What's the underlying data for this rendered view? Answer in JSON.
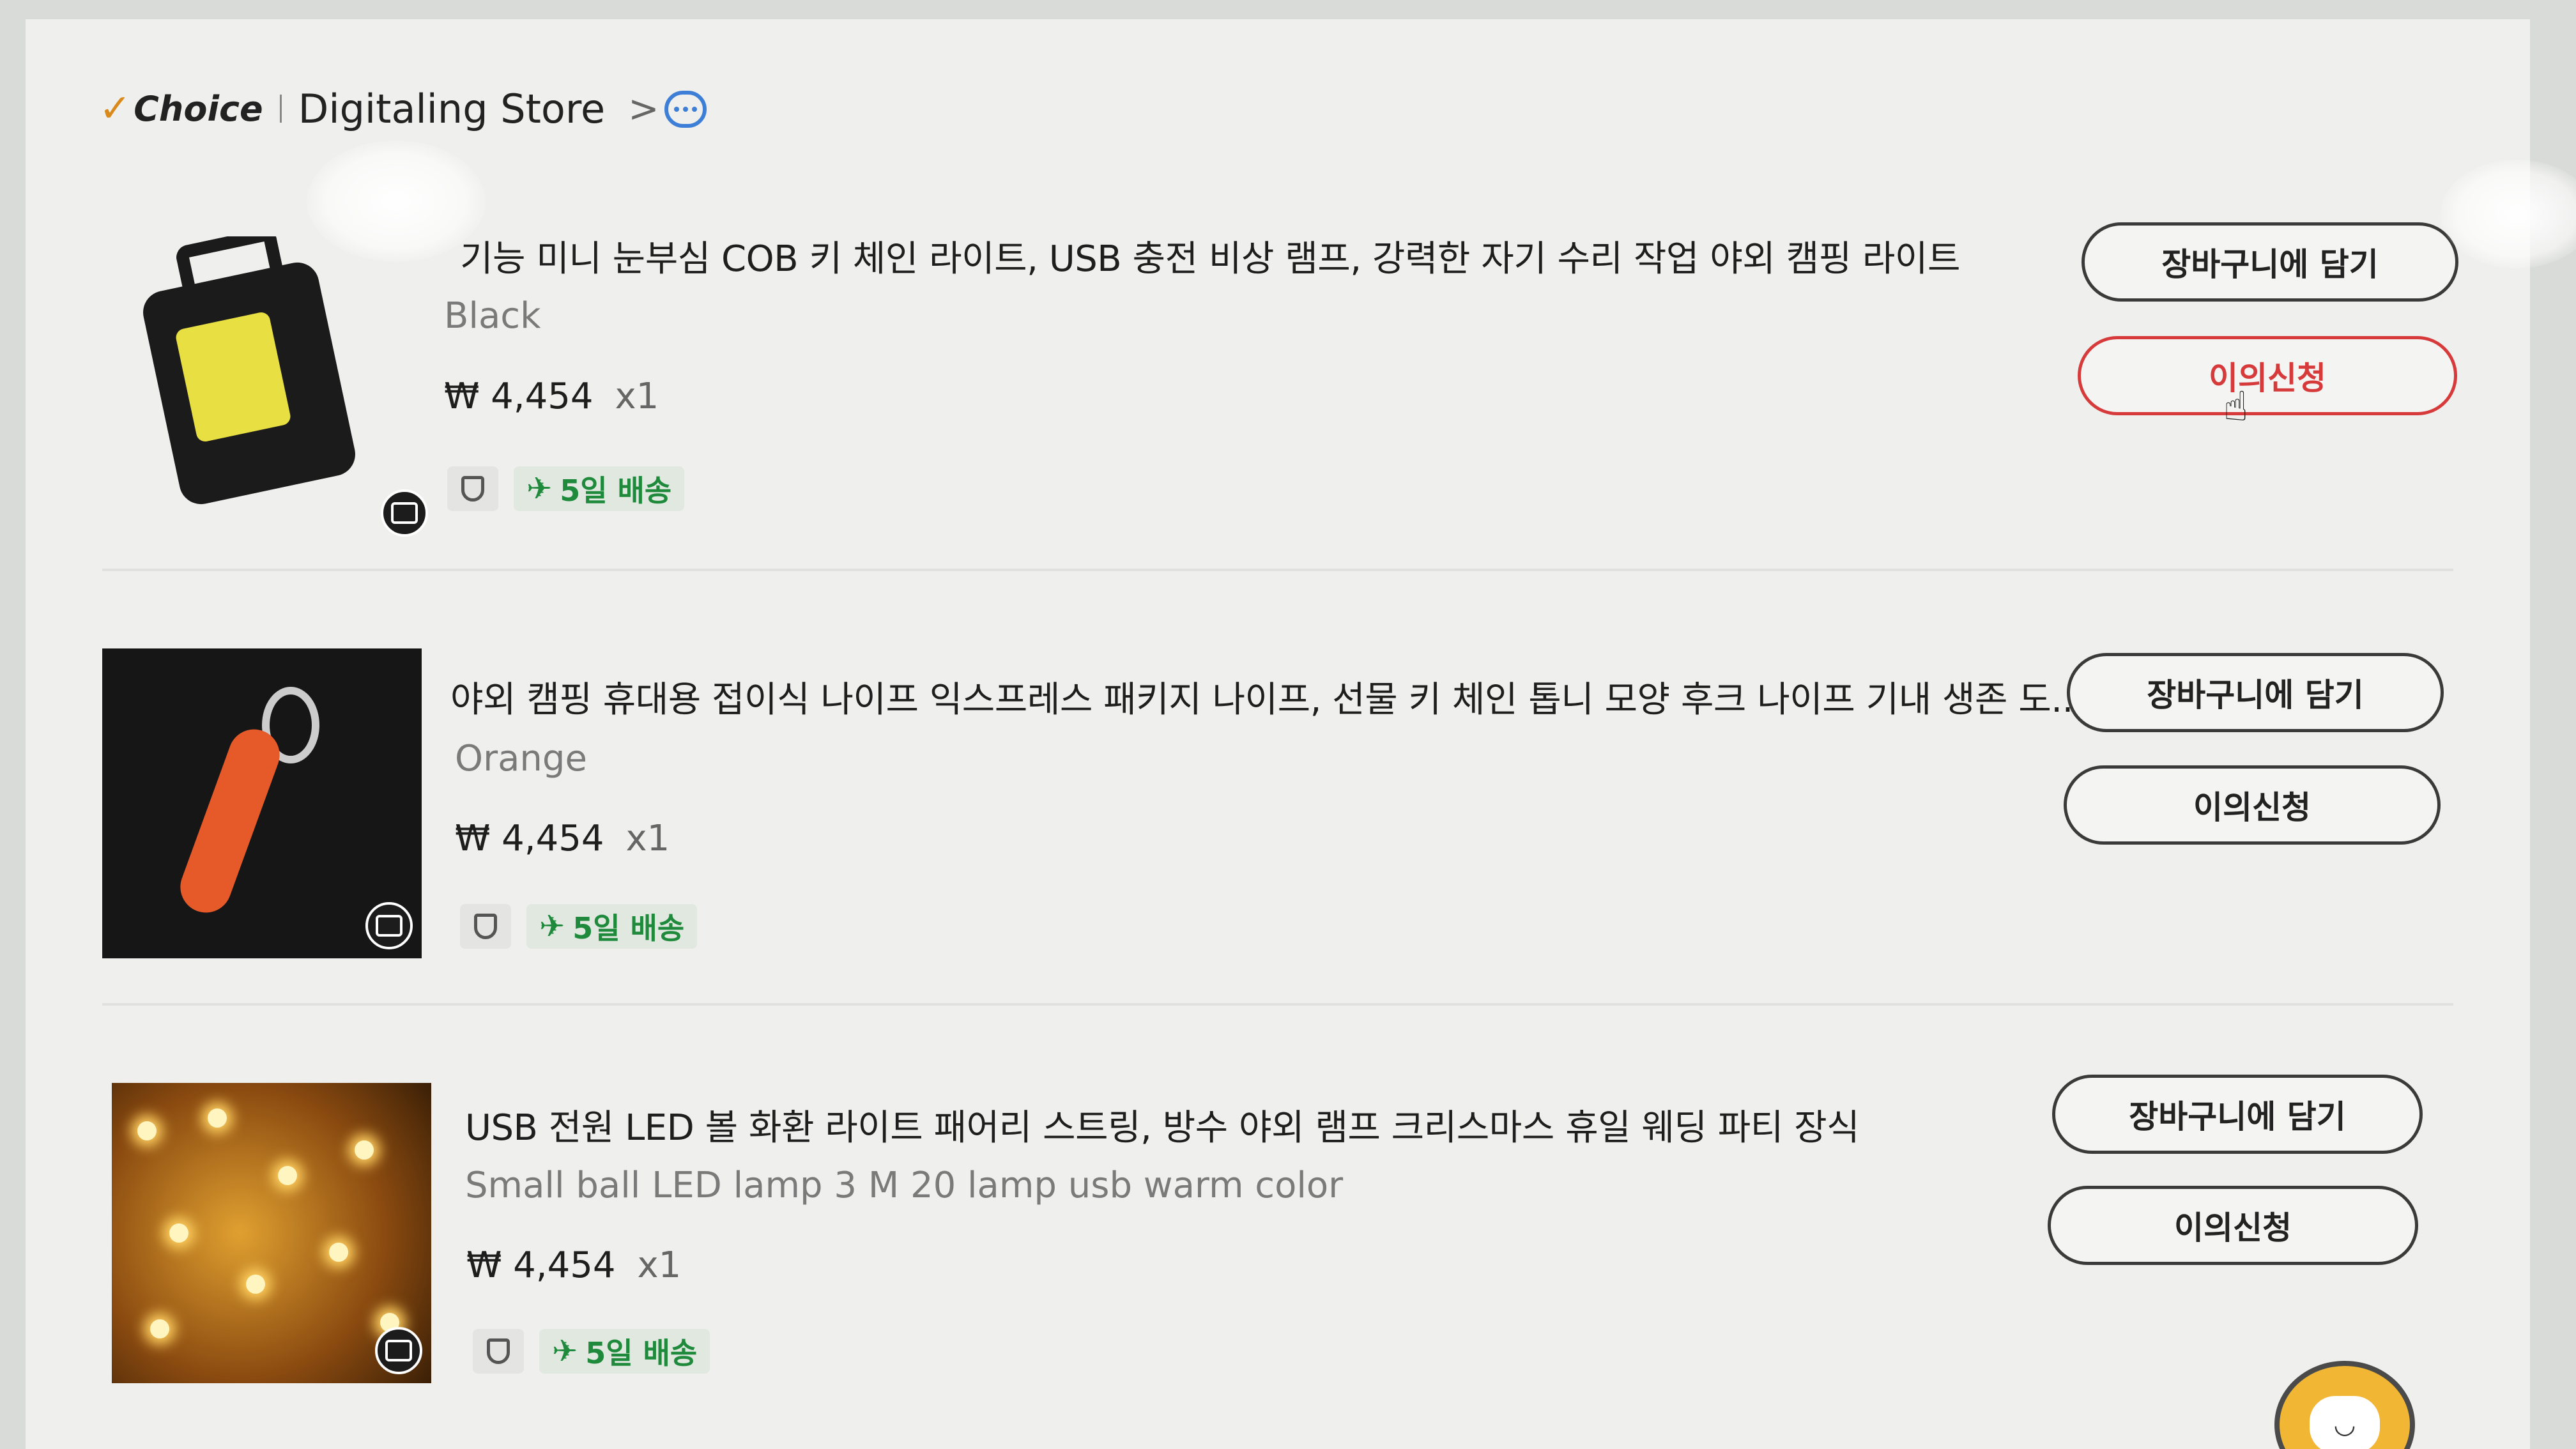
{
  "store": {
    "choice_check": "✓",
    "choice_label": "Choice",
    "name": "Digitaling Store",
    "chevron": ">"
  },
  "items": [
    {
      "title": "기능 미니 눈부심 COB 키 체인 라이트, USB 충전 비상 램프, 강력한 자기 수리 작업 야외 캠핑 라이트",
      "variant": "Black",
      "price": "₩ 4,454",
      "qty": "x1",
      "shipping": "5일 배송",
      "add_to_cart": "장바구니에 담기",
      "dispute": "이의신청"
    },
    {
      "title": "야외 캠핑 휴대용 접이식 나이프 익스프레스 패키지 나이프, 선물 키 체인 톱니 모양 후크 나이프 기내 생존 도...",
      "variant": "Orange",
      "price": "₩ 4,454",
      "qty": "x1",
      "shipping": "5일 배송",
      "add_to_cart": "장바구니에 담기",
      "dispute": "이의신청"
    },
    {
      "title": "USB 전원 LED 볼 화환 라이트 패어리 스트링, 방수 야외 램프 크리스마스 휴일 웨딩 파티 장식",
      "variant": "Small ball LED lamp 3 M 20 lamp usb warm color",
      "price": "₩ 4,454",
      "qty": "x1",
      "shipping": "5일 배송",
      "add_to_cart": "장바구니에 담기",
      "dispute": "이의신청"
    }
  ],
  "icons": {
    "chat": "chat-bubble-icon",
    "camera": "camera-icon",
    "shield": "shield-check-icon",
    "plane": "airplane-icon",
    "cursor": "hand-pointer-icon"
  },
  "colors": {
    "dispute_active": "#d73a3a",
    "shipping_green": "#1f8a3c",
    "chat_blue": "#3d7fd6",
    "choice_orange": "#d98a1a"
  }
}
